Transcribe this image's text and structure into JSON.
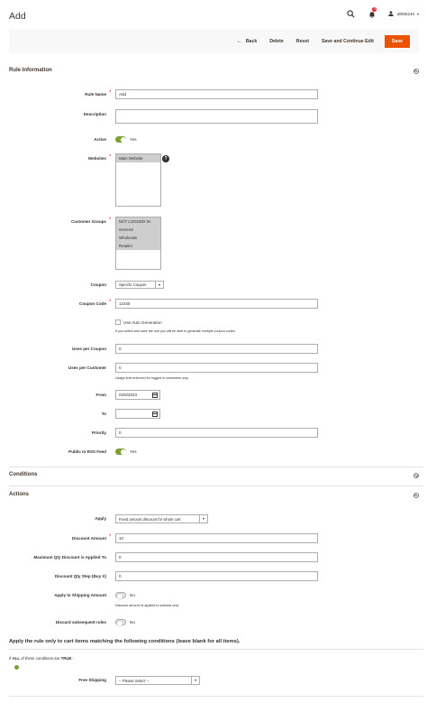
{
  "page": {
    "title": "Add"
  },
  "header": {
    "notifications_count": "3",
    "username": "ali906240",
    "search_icon": "search-icon",
    "bell_icon": "bell-icon",
    "user_icon": "user-icon"
  },
  "toolbar": {
    "back": "Back",
    "delete": "Delete",
    "reset": "Reset",
    "save_continue": "Save and Continue Edit",
    "save": "Save"
  },
  "sections": {
    "rule_information": "Rule Information",
    "conditions": "Conditions",
    "actions": "Actions"
  },
  "form": {
    "rule_name": {
      "label": "Rule Name",
      "value": "Add"
    },
    "description": {
      "label": "Description",
      "value": ""
    },
    "active": {
      "label": "Active",
      "value": "Yes",
      "on": true
    },
    "websites": {
      "label": "Websites",
      "options": [
        "Main Website"
      ]
    },
    "customer_groups": {
      "label": "Customer Groups",
      "options": [
        "NOT LOGGED IN",
        "General",
        "Wholesale",
        "Retailer"
      ]
    },
    "coupon": {
      "label": "Coupon",
      "value": "Specific Coupon"
    },
    "coupon_code": {
      "label": "Coupon Code",
      "value": "12345"
    },
    "auto_generation": {
      "label": "Use Auto Generation",
      "note": "If you select and save the rule you will be able to generate multiple coupon codes."
    },
    "uses_per_coupon": {
      "label": "Uses per Coupon",
      "value": "0"
    },
    "uses_per_customer": {
      "label": "Uses per Customer",
      "value": "0",
      "note": "Usage limit enforced for logged in customers only."
    },
    "from": {
      "label": "From",
      "value": "02/6/2023"
    },
    "to": {
      "label": "To",
      "value": ""
    },
    "priority": {
      "label": "Priority",
      "value": "0"
    },
    "rss": {
      "label": "Public In RSS Feed",
      "value": "Yes",
      "on": true
    }
  },
  "actions": {
    "apply": {
      "label": "Apply",
      "value": "Fixed amount discount for whole cart"
    },
    "discount_amount": {
      "label": "Discount Amount",
      "value": "10"
    },
    "max_qty": {
      "label": "Maximum Qty Discount is Applied To",
      "value": "0"
    },
    "qty_step": {
      "label": "Discount Qty Step (Buy X)",
      "value": "0"
    },
    "shipping": {
      "label": "Apply to Shipping Amount",
      "value": "No",
      "on": false,
      "note": "Discount amount is applied to subtotal only."
    },
    "discard": {
      "label": "Discard subsequent rules",
      "value": "No",
      "on": false
    }
  },
  "cart_conditions": {
    "heading": "Apply the rule only to cart items matching the following conditions (leave blank for all items).",
    "prefix": "If",
    "all": "ALL",
    "middle": "of these conditions are",
    "true_word": "TRUE",
    "suffix": ":"
  },
  "free_shipping": {
    "label": "Free Shipping",
    "value": "-- Please Select --"
  }
}
